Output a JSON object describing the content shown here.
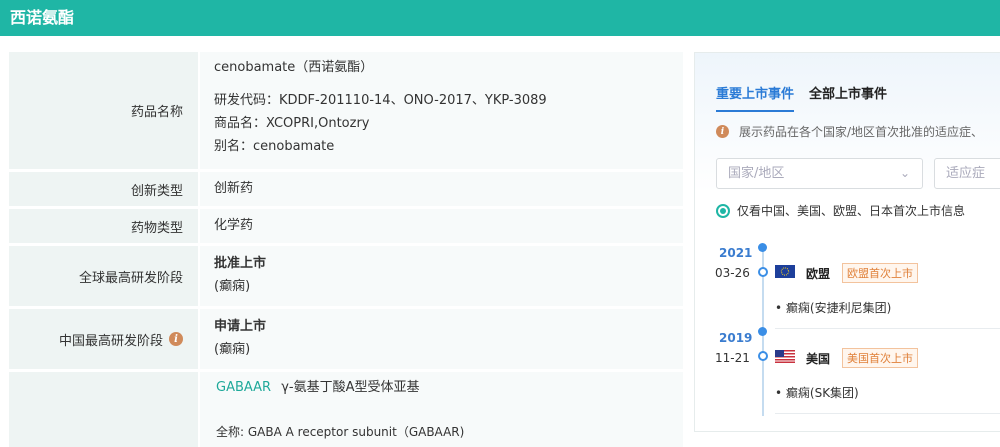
{
  "header": {
    "title": "西诺氨酯"
  },
  "info_rows": {
    "drug_name": {
      "label": "药品名称",
      "lines": [
        "cenobamate（西诺氨酯）",
        "研发代码：KDDF-201110-14、ONO-2017、YKP-3089",
        "商品名：XCOPRI,Ontozry",
        "别名：cenobamate"
      ]
    },
    "innovation_type": {
      "label": "创新类型",
      "value": "创新药"
    },
    "drug_type": {
      "label": "药物类型",
      "value": "化学药"
    },
    "global_stage": {
      "label": "全球最高研发阶段",
      "value": "批准上市",
      "sub": "(癫痫)"
    },
    "china_stage": {
      "label": "中国最高研发阶段",
      "value": "申请上市",
      "sub": "(癫痫)"
    },
    "target": {
      "label": "",
      "target_name": "GABAAR",
      "target_desc": "γ-氨基丁酸A型受体亚基",
      "full_name": "全称:  GABA A receptor subunit（GABAAR)"
    }
  },
  "panel": {
    "tabs": [
      {
        "label": "重要上市事件",
        "active": true
      },
      {
        "label": "全部上市事件",
        "active": false
      }
    ],
    "note": "展示药品在各个国家/地区首次批准的适应症、",
    "filters": {
      "country_placeholder": "国家/地区",
      "indication_placeholder": "适应症"
    },
    "radio_label": "仅看中国、美国、欧盟、日本首次上市信息",
    "events": [
      {
        "year": "2021",
        "date": "03-26",
        "flag": "eu-flag",
        "region": "欧盟",
        "badge": "欧盟首次上市",
        "desc": "• 癫痫(安捷利尼集团)"
      },
      {
        "year": "2019",
        "date": "11-21",
        "flag": "us-flag",
        "region": "美国",
        "badge": "美国首次上市",
        "desc": "• 癫痫(SK集团)"
      }
    ]
  },
  "colors": {
    "brand": "#1fb6a5",
    "link_blue": "#2b7bd6",
    "badge_orange": "#e0813a",
    "info_icon": "#d08a5a"
  }
}
